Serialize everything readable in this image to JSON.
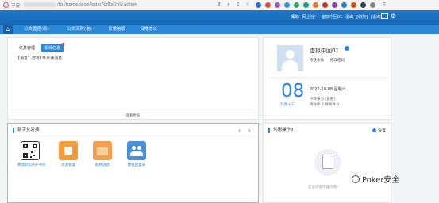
{
  "browser": {
    "security_label": "不安",
    "url": "/tpl/homepage/loginForEsOnly.action"
  },
  "header": {
    "links": [
      "帮助",
      "网上社！",
      "虚拟中回01",
      "退出",
      "[切换]",
      "[退出]"
    ],
    "colors": {
      "primary": "#1f78c9",
      "accent": "#2b86d8"
    }
  },
  "nav": {
    "home_icon": "home-icon",
    "items": [
      "公文管理(新)",
      "公文流转(老)",
      "日常信息",
      "日常办公"
    ]
  },
  "notice": {
    "tabs": [
      "信息管理",
      "系统信息"
    ],
    "message": "【消息】您有1条未读消息",
    "more": "查看更多"
  },
  "profile": {
    "name": "虚拟中回01",
    "links": [
      "修改头像",
      "修改密码"
    ],
    "big_date": "08",
    "lunar": "九月十三",
    "date_line": "2022-10-08  星期六",
    "today_line1": "今日事务 [查看]",
    "today_line2": "待办件 0  待阅件 0"
  },
  "apps": {
    "title": "数字化对接",
    "items": [
      {
        "label": "移动办公(扫一扫)",
        "icon": "qr-code-icon",
        "color": "#ffffff"
      },
      {
        "label": "资源管理",
        "icon": "resource-icon",
        "color": "#f39c3c"
      },
      {
        "label": "网络消息",
        "icon": "folder-icon",
        "color": "#f0a050"
      },
      {
        "label": "数据回复表",
        "icon": "people-icon",
        "color": "#4a90d9"
      }
    ]
  },
  "ops": {
    "title": "常用操作3",
    "setting": "设置",
    "empty_text": "还没有常用操作哦！"
  },
  "watermark": {
    "text": "Poker安全"
  }
}
